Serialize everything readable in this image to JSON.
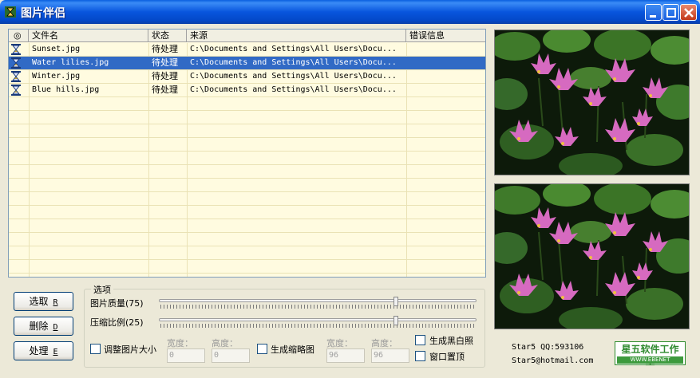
{
  "window": {
    "title": "图片伴侣",
    "icon": "hourglass-app-icon",
    "controls": [
      "minimize",
      "maximize",
      "close"
    ],
    "title_color": "#0a5fe0"
  },
  "list": {
    "columns": [
      "◎",
      "文件名",
      "状态",
      "来源",
      "错误信息"
    ],
    "rows": [
      {
        "icon": "hourglass-icon",
        "name": "Sunset.jpg",
        "status": "待处理",
        "source": "C:\\Documents and Settings\\All Users\\Docu...",
        "error": "",
        "selected": false
      },
      {
        "icon": "hourglass-icon",
        "name": "Water lilies.jpg",
        "status": "待处理",
        "source": "C:\\Documents and Settings\\All Users\\Docu...",
        "error": "",
        "selected": true
      },
      {
        "icon": "hourglass-icon",
        "name": "Winter.jpg",
        "status": "待处理",
        "source": "C:\\Documents and Settings\\All Users\\Docu...",
        "error": "",
        "selected": false
      },
      {
        "icon": "hourglass-icon",
        "name": "Blue hills.jpg",
        "status": "待处理",
        "source": "C:\\Documents and Settings\\All Users\\Docu...",
        "error": "",
        "selected": false
      }
    ],
    "selection_color": "#316ac5",
    "background_color": "#fffbe0"
  },
  "buttons": {
    "select": {
      "label": "选取",
      "accel": "R"
    },
    "delete": {
      "label": "删除",
      "accel": "D"
    },
    "process": {
      "label": "处理",
      "accel": "E"
    }
  },
  "options": {
    "title": "选项",
    "quality": {
      "label": "图片质量(75)",
      "value": 75
    },
    "scale": {
      "label": "压缩比例(25)",
      "value": 25
    },
    "resize": {
      "label": "调整图片大小",
      "checked": false,
      "width_label": "宽度：",
      "height_label": "高度：",
      "width": "0",
      "height": "0"
    },
    "thumbnail": {
      "label": "生成缩略图",
      "checked": false,
      "width_label": "宽度：",
      "height_label": "高度：",
      "width": "96",
      "height": "96"
    },
    "grayscale": {
      "label": "生成黑白照",
      "checked": false
    },
    "ontop": {
      "label": "窗口置顶",
      "checked": false
    }
  },
  "credits": {
    "qq": "Star5 QQ:593106",
    "email": "Star5@hotmail.com",
    "logo_top": "星五软件工作室",
    "logo_bottom": "WWW.EBENET",
    "logo_color": "#3d9a3d"
  },
  "previews": {
    "top": "water-lily-photo",
    "bottom": "water-lily-photo"
  }
}
